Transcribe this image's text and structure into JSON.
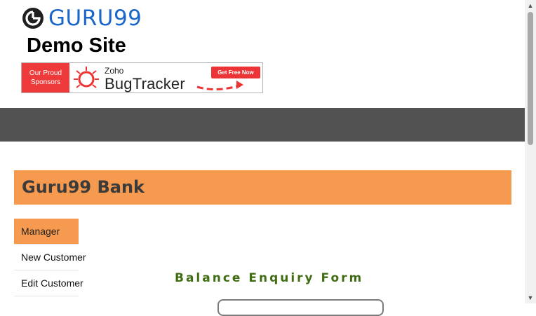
{
  "brand": {
    "logo_text": "GURU99",
    "logo_icon": "guru99-logo-icon",
    "brand_color": "#1a66c9"
  },
  "site_title": "Demo Site",
  "sponsor": {
    "left_line1": "Our Proud",
    "left_line2": "Sponsors",
    "zoho": "Zoho",
    "product": "BugTracker",
    "cta": "Get Free Now",
    "accent": "#ee3a3a"
  },
  "navbar": {
    "color": "#525252"
  },
  "bank": {
    "title": "Guru99 Bank",
    "header_color": "#f59a4e"
  },
  "menu": {
    "items": [
      {
        "label": "Manager",
        "active": true
      },
      {
        "label": "New Customer",
        "active": false
      },
      {
        "label": "Edit Customer",
        "active": false
      }
    ]
  },
  "form": {
    "title": "Balance Enquiry Form",
    "title_color": "#3f6e12"
  }
}
